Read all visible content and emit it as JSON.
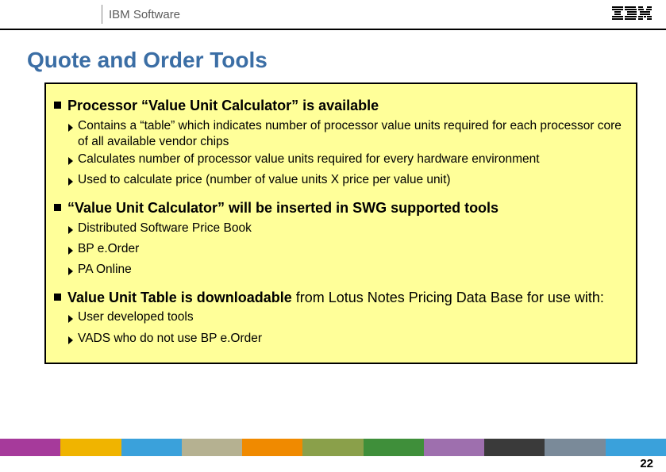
{
  "header": {
    "brand_area": "IBM Software"
  },
  "title": "Quote and Order Tools",
  "bullets": [
    {
      "text_html": "<span class='bold'>Processor “Value Unit Calculator” is available</span>",
      "subs": [
        "Contains a “table” which indicates number of processor value units required for each processor core of all available vendor chips",
        "Calculates number of processor value units required for every hardware environment",
        "Used to calculate price (number of value units X price per value unit)"
      ]
    },
    {
      "text_html": "<span class='bold'>“Value Unit Calculator” will be inserted in SWG supported tools</span>",
      "subs": [
        "Distributed Software Price Book",
        "BP e.Order",
        "PA Online"
      ]
    },
    {
      "text_html": "<span class='bold'>Value Unit Table is downloadable</span> from Lotus Notes Pricing Data Base for use with:",
      "subs": [
        "User developed tools",
        "VADS who do not use BP e.Order"
      ]
    }
  ],
  "page_number": "22",
  "footer_colors": [
    "#a63a9b",
    "#f0b400",
    "#3aa1db",
    "#b5b191",
    "#f08a00",
    "#8aa04a",
    "#3f8f3a",
    "#9e6fae",
    "#3a3a3a",
    "#7a8a99",
    "#3aa1db"
  ]
}
